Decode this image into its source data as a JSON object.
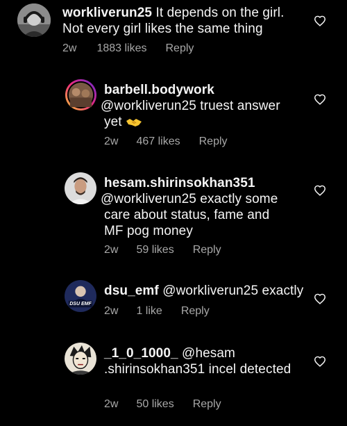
{
  "comments": [
    {
      "username": "workliverun25",
      "text": " It depends on the girl. Not every girl likes the same thing",
      "age": "2w",
      "likes": "1883 likes",
      "reply": "Reply",
      "avatar": "avatar-grey-headphones",
      "indent": false
    },
    {
      "username": "barbell.bodywork",
      "text": " @workliverun25 truest answer yet",
      "emoji": "handshake-emoji",
      "age": "2w",
      "likes": "467 likes",
      "reply": "Reply",
      "avatar": "avatar-gradient-ring",
      "indent": true
    },
    {
      "username": "hesam.shirinsokhan351",
      "text": " @workliverun25 exactly some care about status, fame and MF pog money",
      "age": "2w",
      "likes": "59 likes",
      "reply": "Reply",
      "avatar": "avatar-man-portrait",
      "indent": true
    },
    {
      "username": "dsu_emf",
      "text": " @workliverun25 exactly",
      "age": "2w",
      "likes": "1 like",
      "reply": "Reply",
      "avatar": "avatar-dsu-emf-logo",
      "avatar_text": "DSU EMF",
      "indent": true
    },
    {
      "username": "_1_0_1000_",
      "text": " @hesam .shirinsokhan351 incel detected",
      "age": "2w",
      "likes": "50 likes",
      "reply": "Reply",
      "avatar": "avatar-anime-sketch",
      "indent": true
    }
  ],
  "colors": {
    "background": "#000000",
    "text": "#f5f5f5",
    "meta": "#a8a8a8",
    "heart": "#f5f5f5",
    "brand_gradient": [
      "#f9ce34",
      "#ee2a7b",
      "#6228d7"
    ]
  }
}
